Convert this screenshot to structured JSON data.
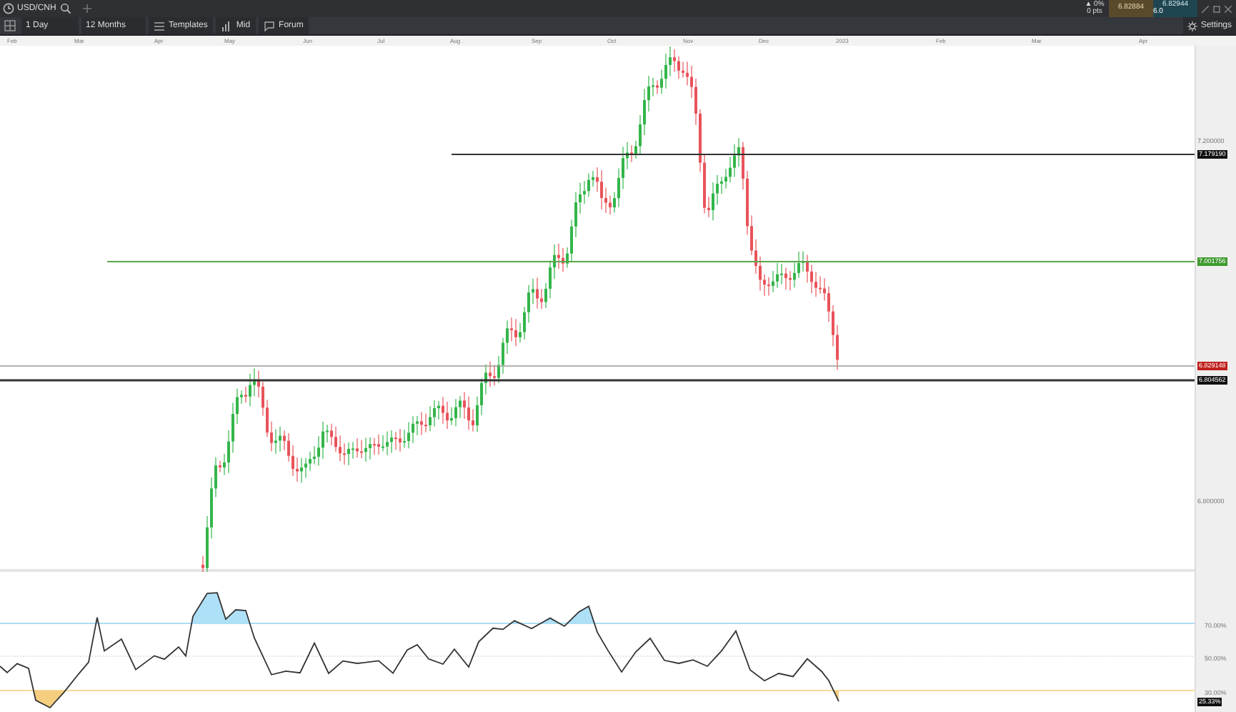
{
  "instrument": {
    "symbol": "USD/CNH"
  },
  "quote": {
    "change": "▲ 0%",
    "change_points": "0 pts",
    "sell": "6.82884",
    "buy": "6.82944",
    "spread": "6.0"
  },
  "toolbar": {
    "interval": "1 Day",
    "range": "12 Months",
    "buttons": [
      {
        "kind": "templates",
        "label": "Templates"
      },
      {
        "kind": "mid",
        "label": "Mid"
      },
      {
        "kind": "forum",
        "label": "Forum"
      }
    ],
    "settings": "Settings"
  },
  "time_axis": [
    "Feb",
    "Mar",
    "Apr",
    "May",
    "Jun",
    "Jul",
    "Aug",
    "Sep",
    "Oct",
    "Nov",
    "Dec",
    "2023",
    "Feb",
    "Mar",
    "Apr"
  ],
  "price_axis": [
    "7.200000",
    "6.800000"
  ],
  "levels": [
    {
      "label": "7.179190",
      "color": "#111111"
    },
    {
      "label": "7.001756",
      "color": "#3e9a2e"
    },
    {
      "label": "6.829148",
      "color": "#c0201c"
    },
    {
      "label": "6.804562",
      "color": "#111111"
    }
  ],
  "rsi_axis": [
    "70.00%",
    "50.00%",
    "30.00%"
  ],
  "rsi_value": "25.33%"
}
